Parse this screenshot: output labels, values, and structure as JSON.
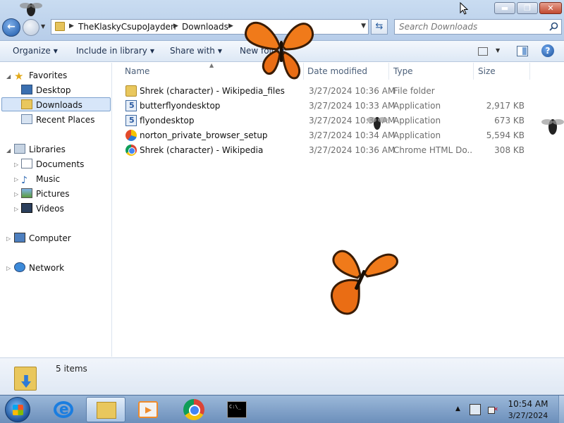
{
  "window": {
    "caption_buttons": {
      "minimize": "▬",
      "maximize": "❐",
      "close": "✕"
    },
    "breadcrumb": [
      "TheKlaskyCsupoJayden",
      "Downloads"
    ],
    "search_placeholder": "Search Downloads"
  },
  "toolbar": {
    "organize": "Organize",
    "include": "Include in library",
    "share": "Share with",
    "new_folder": "New folder",
    "help": "?"
  },
  "nav": {
    "favorites": "Favorites",
    "desktop": "Desktop",
    "downloads": "Downloads",
    "recent": "Recent Places",
    "libraries": "Libraries",
    "documents": "Documents",
    "music": "Music",
    "pictures": "Pictures",
    "videos": "Videos",
    "computer": "Computer",
    "network": "Network"
  },
  "columns": {
    "name": "Name",
    "date": "Date modified",
    "type": "Type",
    "size": "Size"
  },
  "files": [
    {
      "name": "Shrek (character) - Wikipedia_files",
      "date": "3/27/2024 10:36 AM",
      "type": "File folder",
      "size": "",
      "icon": "folder-icon"
    },
    {
      "name": "butterflyondesktop",
      "date": "3/27/2024 10:33 AM",
      "type": "Application",
      "size": "2,917 KB",
      "icon": "installer-icon"
    },
    {
      "name": "flyondesktop",
      "date": "3/27/2024 10:34 AM",
      "type": "Application",
      "size": "673 KB",
      "icon": "installer-icon"
    },
    {
      "name": "norton_private_browser_setup",
      "date": "3/27/2024 10:34 AM",
      "type": "Application",
      "size": "5,594 KB",
      "icon": "norton-icon"
    },
    {
      "name": "Shrek (character) - Wikipedia",
      "date": "3/27/2024 10:36 AM",
      "type": "Chrome HTML Do...",
      "size": "308 KB",
      "icon": "chrome-icon"
    }
  ],
  "details": {
    "count": "5 items"
  },
  "taskbar": {
    "time": "10:54 AM",
    "date": "3/27/2024"
  },
  "colors": {
    "selection": "#d7e6f9",
    "butterfly_orange": "#f07a1a",
    "taskbar": "#7f9fc7"
  }
}
